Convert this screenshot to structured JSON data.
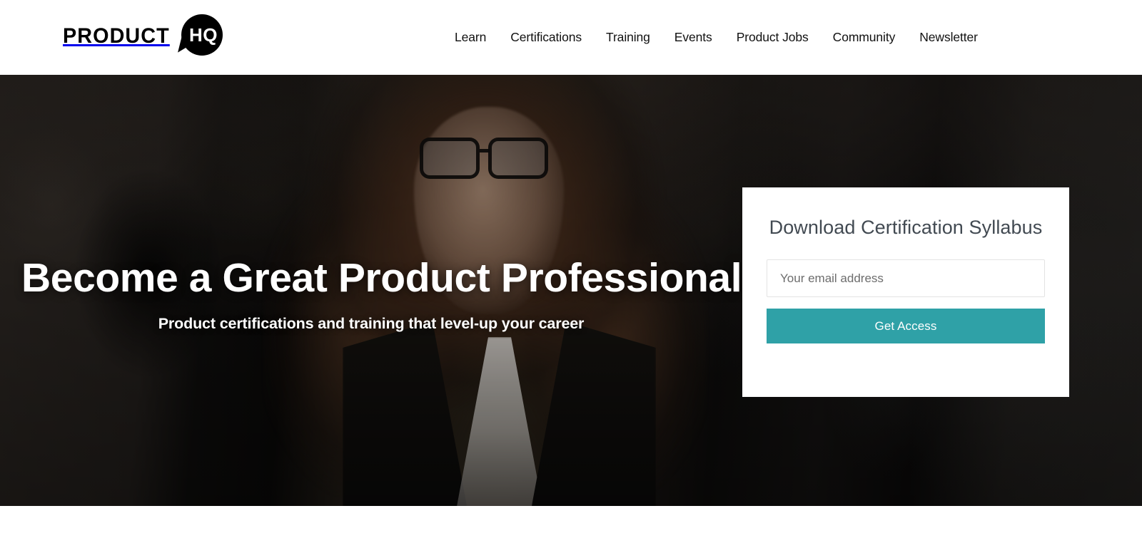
{
  "header": {
    "logo": {
      "word": "PRODUCT",
      "badge": "HQ"
    },
    "nav": [
      {
        "label": "Learn"
      },
      {
        "label": "Certifications"
      },
      {
        "label": "Training"
      },
      {
        "label": "Events"
      },
      {
        "label": "Product Jobs"
      },
      {
        "label": "Community"
      },
      {
        "label": "Newsletter"
      }
    ]
  },
  "hero": {
    "title": "Become a Great Product Professional",
    "subtitle": "Product certifications and training that level-up your career",
    "signup": {
      "title": "Download Certification Syllabus",
      "email_placeholder": "Your email address",
      "email_value": "",
      "submit_label": "Get Access",
      "accent_color": "#2fa1a7"
    }
  },
  "colors": {
    "header_bg": "#ffffff",
    "nav_text": "#111111",
    "hero_bg": "#1a1715",
    "hero_text": "#ffffff",
    "card_bg": "#ffffff",
    "card_title": "#424a52",
    "button_bg": "#2fa1a7",
    "button_text": "#ffffff",
    "input_border": "#e3e3e3",
    "placeholder": "#6d6d6d"
  }
}
